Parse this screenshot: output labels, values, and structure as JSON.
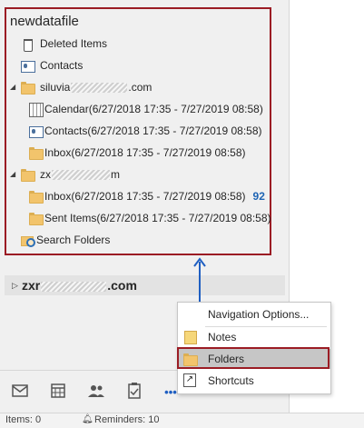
{
  "tree": {
    "root": "newdatafile",
    "deleted_items": "Deleted Items",
    "contacts": "Contacts",
    "account1_prefix": "siluvia",
    "account1_suffix": ".com",
    "calendar": "Calendar(6/27/2018 17:35 - 7/27/2019 08:58)",
    "contacts_dated": "Contacts(6/27/2018 17:35 - 7/27/2019 08:58)",
    "inbox1": "Inbox(6/27/2018 17:35 - 7/27/2019 08:58)",
    "account2_prefix": "zx",
    "account2_suffix": "m",
    "inbox2": "Inbox(6/27/2018 17:35 - 7/27/2019 08:58)",
    "inbox2_count": "92",
    "sent_items": "Sent Items(6/27/2018 17:35 - 7/27/2019 08:58)",
    "search_folders": "Search Folders"
  },
  "account_collapsed": {
    "prefix": "zxr",
    "suffix": ".com"
  },
  "nav": {
    "mail_icon": "mail-icon",
    "calendar_icon": "calendar-icon",
    "people_icon": "people-icon",
    "tasks_icon": "tasks-icon",
    "more_icon": "more-icon",
    "more_label": "•••"
  },
  "menu": {
    "navigation_options": "Navigation Options...",
    "notes": "Notes",
    "folders": "Folders",
    "shortcuts": "Shortcuts"
  },
  "status": {
    "items": "Items: 0",
    "reminders": "Reminders: 10"
  },
  "colors": {
    "highlight_border": "#9b1c24",
    "arrow": "#1f5fc2",
    "unread_count": "#1e64b4"
  }
}
